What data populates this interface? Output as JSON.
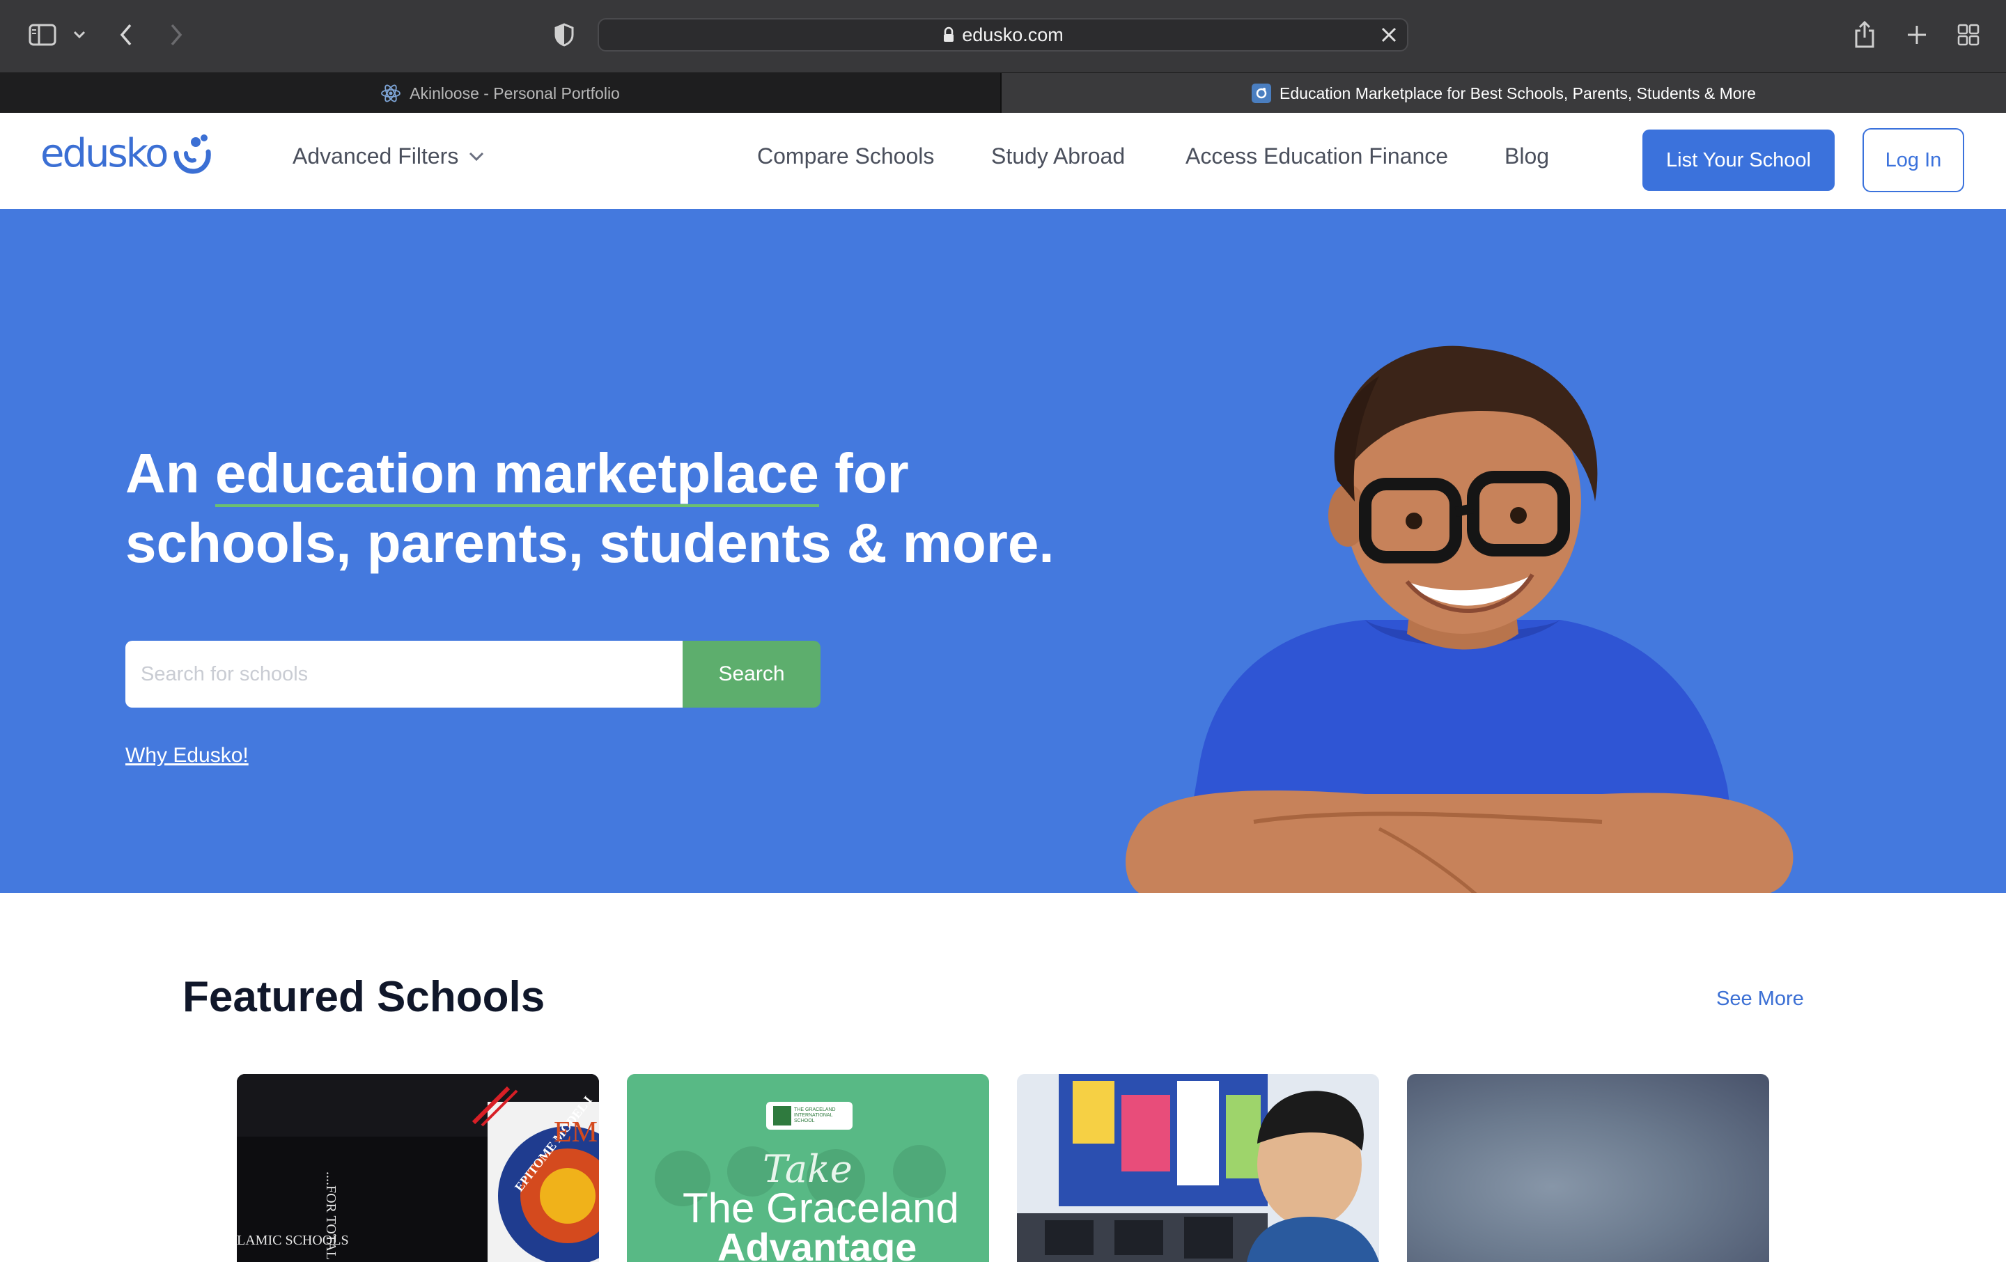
{
  "browser": {
    "url": "edusko.com",
    "tabs": [
      {
        "title": "Akinloose - Personal Portfolio",
        "active": false
      },
      {
        "title": "Education Marketplace for Best Schools, Parents, Students & More",
        "active": true
      }
    ]
  },
  "header": {
    "logo_text": "edusko",
    "nav": {
      "advanced_filters": "Advanced Filters",
      "compare_schools": "Compare Schools",
      "study_abroad": "Study Abroad",
      "access_finance": "Access Education Finance",
      "blog": "Blog"
    },
    "list_school": "List Your School",
    "login": "Log In"
  },
  "hero": {
    "title_prefix": "An ",
    "title_highlight": "education marketplace",
    "title_suffix": " for schools, parents, students & more.",
    "search_placeholder": "Search for schools",
    "search_button": "Search",
    "why_link": "Why Edusko!"
  },
  "featured": {
    "title": "Featured Schools",
    "see_more": "See More",
    "cards": [
      {
        "caption_left": "LAMIC SCHOOLS",
        "caption_vertical": "....FOR TOTAL ACAD",
        "badge_text": "EPITOME MODEL I",
        "badge_letters": "EM"
      },
      {
        "badge_text": "THE GRACELAND INTERNATIONAL SCHOOL",
        "script_text": "Take",
        "headline": "The Graceland",
        "subheadline": "Advantage"
      },
      {},
      {}
    ]
  },
  "colors": {
    "brand_blue": "#3b72dc",
    "hero_bg": "#4479de",
    "search_green": "#5dae6d",
    "underline_green": "#6cc06f"
  }
}
